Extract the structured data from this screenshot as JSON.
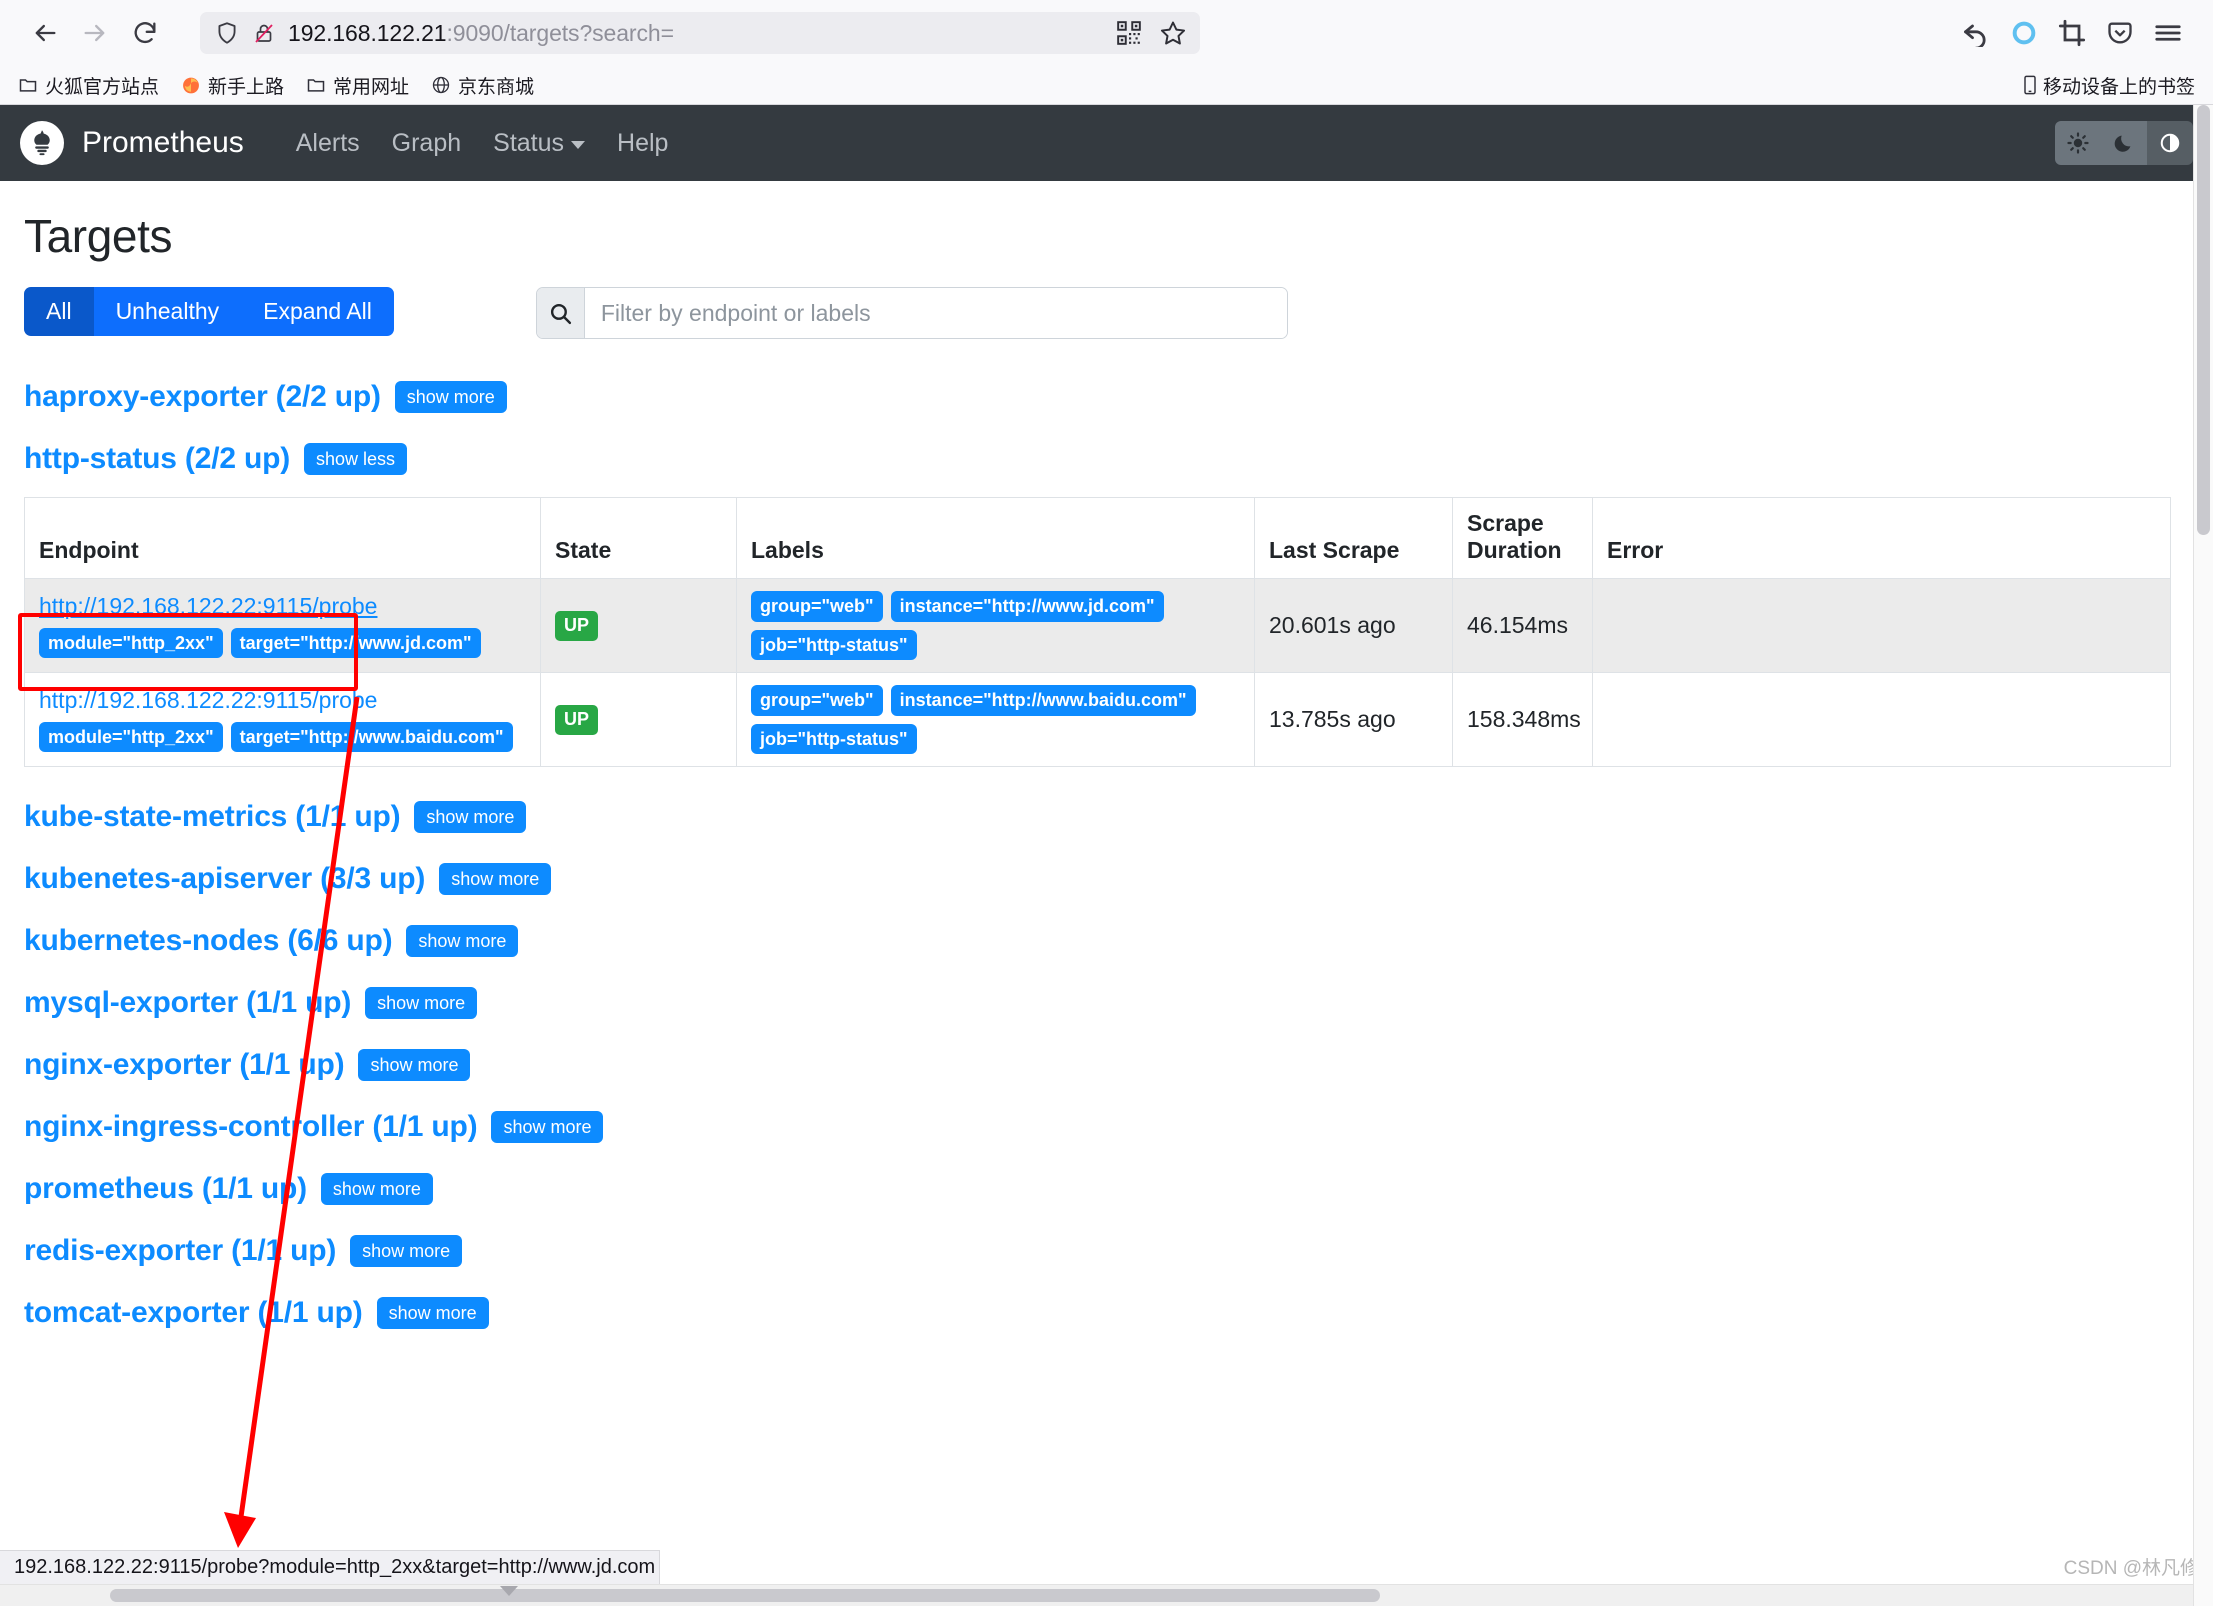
{
  "browser": {
    "back_icon": "back-arrow-icon",
    "forward_icon": "forward-arrow-icon",
    "reload_icon": "reload-icon",
    "url_host": "192.168.122.21",
    "url_rest": ":9090/targets?search=",
    "url_full": "192.168.122.21:9090/targets?search=",
    "shield_icon": "shield-icon",
    "insecure_icon": "insecure-lock-icon",
    "qr_icon": "qr-code-icon",
    "bookmark_star_icon": "bookmark-star-icon",
    "toolbar_right": [
      {
        "name": "history-back-icon",
        "glyph": "history"
      },
      {
        "name": "sync-circle-icon",
        "glyph": "circle"
      },
      {
        "name": "screenshot-crop-icon",
        "glyph": "crop"
      },
      {
        "name": "pocket-icon",
        "glyph": "pocket"
      },
      {
        "name": "hamburger-menu-icon",
        "glyph": "menu"
      }
    ],
    "bookmarks": [
      {
        "label": "火狐官方站点",
        "icon": "folder-icon"
      },
      {
        "label": "新手上路",
        "icon": "firefox-icon"
      },
      {
        "label": "常用网址",
        "icon": "folder-icon"
      },
      {
        "label": "京东商城",
        "icon": "globe-icon"
      }
    ],
    "bookmarks_right": {
      "label": "移动设备上的书签",
      "icon": "mobile-device-icon"
    },
    "status_link": "192.168.122.22:9115/probe?module=http_2xx&target=http://www.jd.com"
  },
  "navbar": {
    "brand": "Prometheus",
    "logo_icon": "prometheus-logo-icon",
    "links": [
      {
        "label": "Alerts",
        "caret": false
      },
      {
        "label": "Graph",
        "caret": false
      },
      {
        "label": "Status",
        "caret": true
      },
      {
        "label": "Help",
        "caret": false
      }
    ],
    "theme_buttons": [
      {
        "name": "theme-light-sun-icon",
        "active": false
      },
      {
        "name": "theme-dark-moon-icon",
        "active": false
      },
      {
        "name": "theme-auto-halfcircle-icon",
        "active": true
      }
    ]
  },
  "page": {
    "title": "Targets",
    "filters": [
      {
        "label": "All",
        "active": true
      },
      {
        "label": "Unhealthy",
        "active": false
      },
      {
        "label": "Expand All",
        "active": false
      }
    ],
    "search": {
      "placeholder": "Filter by endpoint or labels",
      "value": "",
      "icon": "search-icon"
    }
  },
  "jobs_before": [
    {
      "title": "haproxy-exporter (2/2 up)",
      "button": "show more"
    },
    {
      "title": "http-status (2/2 up)",
      "button": "show less"
    }
  ],
  "table": {
    "columns": [
      "Endpoint",
      "State",
      "Labels",
      "Last Scrape",
      "Scrape Duration",
      "Error"
    ],
    "rows": [
      {
        "endpoint": "http://192.168.122.22:9115/probe",
        "endpoint_labels": [
          "module=\"http_2xx\"",
          "target=\"http://www.jd.com\""
        ],
        "state": "UP",
        "labels": [
          "group=\"web\"",
          "instance=\"http://www.jd.com\"",
          "job=\"http-status\""
        ],
        "last_scrape": "20.601s ago",
        "scrape_duration": "46.154ms",
        "error": "",
        "highlighted": true
      },
      {
        "endpoint": "http://192.168.122.22:9115/probe",
        "endpoint_labels": [
          "module=\"http_2xx\"",
          "target=\"http://www.baidu.com\""
        ],
        "state": "UP",
        "labels": [
          "group=\"web\"",
          "instance=\"http://www.baidu.com\"",
          "job=\"http-status\""
        ],
        "last_scrape": "13.785s ago",
        "scrape_duration": "158.348ms",
        "error": "",
        "highlighted": false
      }
    ]
  },
  "jobs_after": [
    {
      "title": "kube-state-metrics (1/1 up)",
      "button": "show more"
    },
    {
      "title": "kubenetes-apiserver (3/3 up)",
      "button": "show more"
    },
    {
      "title": "kubernetes-nodes (6/6 up)",
      "button": "show more"
    },
    {
      "title": "mysql-exporter (1/1 up)",
      "button": "show more"
    },
    {
      "title": "nginx-exporter (1/1 up)",
      "button": "show more"
    },
    {
      "title": "nginx-ingress-controller (1/1 up)",
      "button": "show more"
    },
    {
      "title": "prometheus (1/1 up)",
      "button": "show more"
    },
    {
      "title": "redis-exporter (1/1 up)",
      "button": "show more"
    },
    {
      "title": "tomcat-exporter (1/1 up)",
      "button": "show more"
    }
  ],
  "watermark": "CSDN @林凡修",
  "colors": {
    "navbar_bg": "#343a40",
    "link_blue": "#0d8bff",
    "primary_blue": "#0d6efd",
    "active_blue": "#0a58ca",
    "state_up_green": "#28a745",
    "annotation_red": "#ff0000",
    "row_highlight": "#ebebeb"
  }
}
